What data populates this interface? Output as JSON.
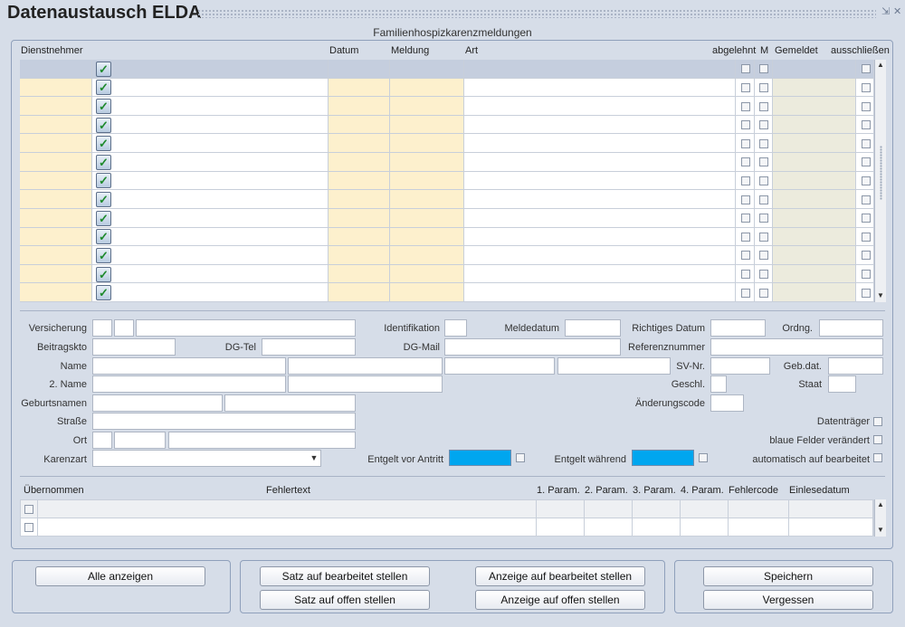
{
  "window": {
    "title": "Datenaustausch ELDA",
    "minimize_icon": "resize-icon",
    "close_icon": "close-icon"
  },
  "section_title": "Familienhospizkarenzmeldungen",
  "grid": {
    "headers": {
      "dienstnehmer": "Dienstnehmer",
      "datum": "Datum",
      "meldung": "Meldung",
      "art": "Art",
      "abgelehnt": "abgelehnt",
      "m": "M",
      "gemeldet": "Gemeldet",
      "ausschliessen": "ausschließen"
    },
    "row_count": 13
  },
  "form": {
    "versicherung": "Versicherung",
    "identifikation": "Identifikation",
    "meldedatum": "Meldedatum",
    "richtiges_datum": "Richtiges Datum",
    "ordng": "Ordng.",
    "beitragskto": "Beitragskto",
    "dg_tel": "DG-Tel",
    "dg_mail": "DG-Mail",
    "referenznummer": "Referenznummer",
    "name": "Name",
    "sv_nr": "SV-Nr.",
    "geb_dat": "Geb.dat.",
    "name2": "2. Name",
    "geschl": "Geschl.",
    "staat": "Staat",
    "geburtsnamen": "Geburtsnamen",
    "aenderungscode": "Änderungscode",
    "strasse": "Straße",
    "datentraeger": "Datenträger",
    "ort": "Ort",
    "blaue_felder": "blaue Felder verändert",
    "karenzart": "Karenzart",
    "entgelt_vor": "Entgelt vor Antritt",
    "entgelt_waehrend": "Entgelt während",
    "automatisch": "automatisch auf bearbeitet"
  },
  "errors": {
    "headers": {
      "uebernommen": "Übernommen",
      "fehlertext": "Fehlertext",
      "param1": "1. Param.",
      "param2": "2. Param.",
      "param3": "3. Param.",
      "param4": "4. Param.",
      "fehlercode": "Fehlercode",
      "einlesedatum": "Einlesedatum"
    }
  },
  "buttons": {
    "alle_anzeigen": "Alle anzeigen",
    "satz_bearbeitet": "Satz auf bearbeitet stellen",
    "satz_offen": "Satz auf offen stellen",
    "anzeige_bearbeitet": "Anzeige auf bearbeitet stellen",
    "anzeige_offen": "Anzeige auf offen stellen",
    "speichern": "Speichern",
    "vergessen": "Vergessen"
  },
  "colors": {
    "background": "#d6dde8",
    "required": "#fdf0cd",
    "blue_field": "#00a6ef",
    "selected_row": "#c5cede"
  }
}
